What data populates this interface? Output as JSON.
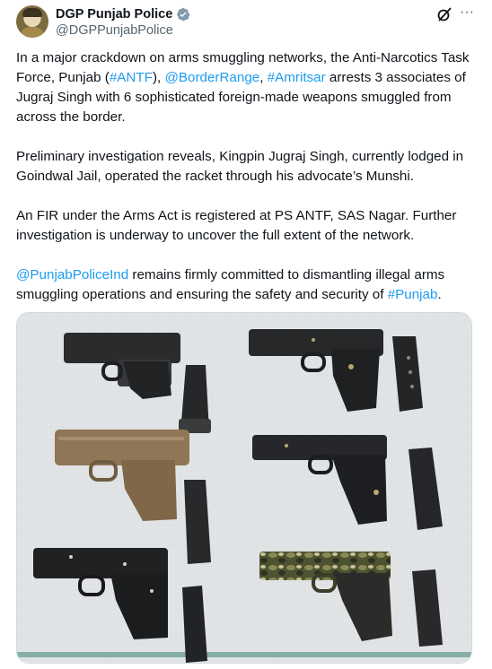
{
  "author": {
    "display_name": "DGP Punjab Police",
    "handle": "@DGPPunjabPolice",
    "verified": true
  },
  "icons": {
    "verified": "verified-badge-icon",
    "grok": "grok-icon",
    "more": "more-options-icon"
  },
  "tweet": {
    "p1": {
      "t1": "In a major crackdown on arms smuggling networks, the Anti-Narcotics Task Force, Punjab (",
      "l1": "#ANTF",
      "t2": "), ",
      "l2": "@BorderRange",
      "t3": ", ",
      "l3": "#Amritsar",
      "t4": " arrests 3 associates of Jugraj Singh with 6 sophisticated foreign-made weapons smuggled from across the border."
    },
    "p2": "Preliminary investigation reveals, Kingpin Jugraj Singh, currently lodged in Goindwal Jail, operated the racket through his advocate’s Munshi.",
    "p3": "An FIR under the Arms Act is registered at PS ANTF, SAS Nagar. Further investigation is underway to uncover the full extent of the network.",
    "p4": {
      "l1": "@PunjabPoliceInd",
      "t1": " remains firmly committed to dismantling illegal arms smuggling operations and ensuring the safety and security of ",
      "l2": "#Punjab",
      "t2": "."
    }
  },
  "colors": {
    "link": "#1d9bf0",
    "text": "#0f1419",
    "muted": "#536471",
    "cloth": "#e4e6e8"
  },
  "media": {
    "description_count_weapons": 6
  }
}
